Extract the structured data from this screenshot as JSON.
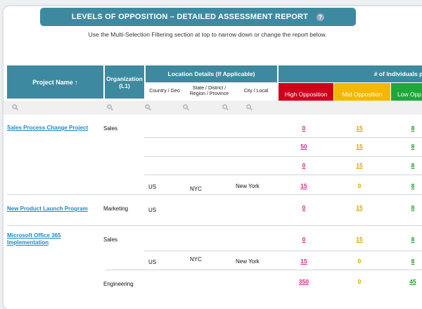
{
  "header": {
    "title": "LEVELS OF OPPOSITION – DETAILED ASSESSMENT REPORT",
    "help_label": "?",
    "subtitle": "Use the Multi-Selection Filtering section at top to narrow down or change the report below."
  },
  "columns": {
    "project_name": "Project Name ↑",
    "organization": "Organization (L1)",
    "location_group": "Location Details (If Applicable)",
    "country": "Country / Geo",
    "state": "State / District / Region / Province",
    "city": "City / Local",
    "individuals_group": "# of Individuals pe",
    "high": "High Opposition",
    "mid": "Mid Opposition",
    "low": "Low Opp"
  },
  "colors": {
    "header_bg": "#3d8aa0",
    "high": "#d0021b",
    "mid": "#f5b700",
    "low": "#1fa83a"
  },
  "rows": [
    {
      "project": "Sales Process Change Project",
      "org": "Sales",
      "country": "",
      "state": "",
      "city": "",
      "high": "0",
      "mid": "15",
      "low": "8"
    },
    {
      "project": "",
      "org": "",
      "country": "",
      "state": "",
      "city": "",
      "high": "50",
      "mid": "15",
      "low": "8"
    },
    {
      "project": "",
      "org": "",
      "country": "",
      "state": "",
      "city": "",
      "high": "0",
      "mid": "15",
      "low": "8"
    },
    {
      "project": "",
      "org": "",
      "country": "US",
      "state": "NYC",
      "city": "New York",
      "high": "15",
      "mid": "0",
      "low": "8"
    },
    {
      "project": "New Product Launch Program",
      "org": "Marketing",
      "country": "US",
      "state": "",
      "city": "",
      "high": "0",
      "mid": "15",
      "low": "8"
    },
    {
      "project": "Microsoft Office 365 Implementation",
      "org": "Sales",
      "country": "",
      "state": "",
      "city": "",
      "high": "0",
      "mid": "15",
      "low": "8"
    },
    {
      "project": "",
      "org": "",
      "country": "US",
      "state": "NYC",
      "city": "New York",
      "high": "15",
      "mid": "0",
      "low": "8"
    },
    {
      "project": "",
      "org": "Engineering",
      "country": "",
      "state": "",
      "city": "",
      "high": "350",
      "mid": "0",
      "low": "45"
    }
  ]
}
